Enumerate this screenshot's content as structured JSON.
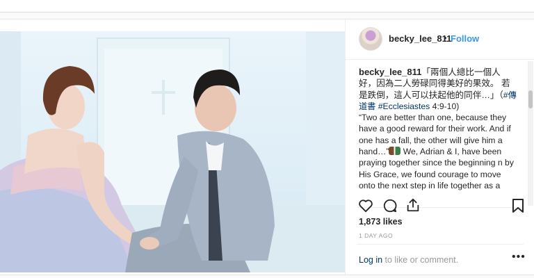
{
  "post": {
    "username": "becky_lee_811",
    "separator": "•",
    "follow_label": "Follow",
    "caption": {
      "username": "becky_lee_811",
      "zh_text": "「兩個人總比一個人好，因為二人勞碌同得美好的果效。 若是跌倒，這人可以扶起他的同伴…」（",
      "tag_zh": "#傳道書",
      "tag_en": "#Ecclesiastes",
      "verse": "4:9-10)",
      "en_quote": "“Two are better than one, because they have a good reward for their work. And if one has a fall, the other will give him a hand…”",
      "body": "We, Adrian & I, have been praying together since the beginning n by His Grace, we found courage to move onto the next step in life together as a team, as life partners, and as a family!"
    },
    "likes": "1,873 likes",
    "time_ago": "1 DAY AGO",
    "login": {
      "link": "Log in",
      "rest": " to like or comment."
    },
    "more_label": "•••"
  },
  "icons": [
    "heart-icon",
    "comment-icon",
    "share-icon",
    "bookmark-icon",
    "more-options-icon"
  ],
  "colors": {
    "link": "#3897f0",
    "tag": "#003569",
    "muted": "#999999",
    "text": "#262626"
  }
}
